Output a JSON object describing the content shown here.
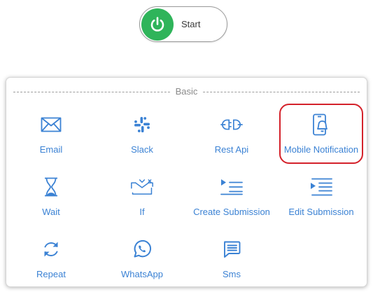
{
  "start": {
    "label": "Start",
    "icon": "power-icon",
    "color": "#2fb45a"
  },
  "palette": {
    "section_title": "Basic",
    "accent_color": "#3b82d4",
    "highlighted_item": "Mobile Notification",
    "items": [
      {
        "label": "Email",
        "icon": "envelope-icon"
      },
      {
        "label": "Slack",
        "icon": "slack-icon"
      },
      {
        "label": "Rest Api",
        "icon": "plug-icon"
      },
      {
        "label": "Mobile Notification",
        "icon": "mobile-bell-icon"
      },
      {
        "label": "Wait",
        "icon": "hourglass-icon"
      },
      {
        "label": "If",
        "icon": "branch-icon"
      },
      {
        "label": "Create Submission",
        "icon": "list-add-icon"
      },
      {
        "label": "Edit Submission",
        "icon": "list-edit-icon"
      },
      {
        "label": "Repeat",
        "icon": "repeat-icon"
      },
      {
        "label": "WhatsApp",
        "icon": "whatsapp-icon"
      },
      {
        "label": "Sms",
        "icon": "message-icon"
      }
    ]
  }
}
